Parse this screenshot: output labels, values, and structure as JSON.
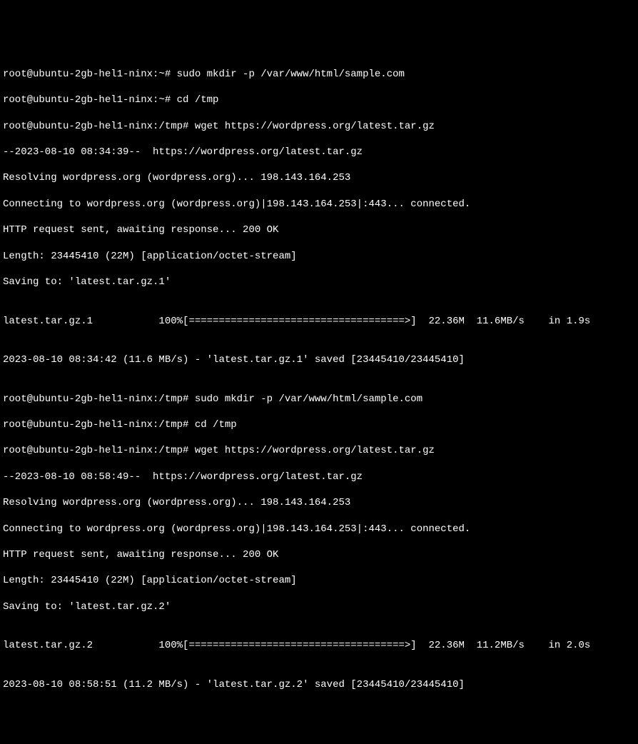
{
  "lines": [
    "root@ubuntu-2gb-hel1-ninx:~# sudo mkdir -p /var/www/html/sample.com",
    "root@ubuntu-2gb-hel1-ninx:~# cd /tmp",
    "root@ubuntu-2gb-hel1-ninx:/tmp# wget https://wordpress.org/latest.tar.gz",
    "--2023-08-10 08:34:39--  https://wordpress.org/latest.tar.gz",
    "Resolving wordpress.org (wordpress.org)... 198.143.164.253",
    "Connecting to wordpress.org (wordpress.org)|198.143.164.253|:443... connected.",
    "HTTP request sent, awaiting response... 200 OK",
    "Length: 23445410 (22M) [application/octet-stream]",
    "Saving to: 'latest.tar.gz.1'",
    "",
    "latest.tar.gz.1           100%[====================================>]  22.36M  11.6MB/s    in 1.9s",
    "",
    "2023-08-10 08:34:42 (11.6 MB/s) - 'latest.tar.gz.1' saved [23445410/23445410]",
    "",
    "root@ubuntu-2gb-hel1-ninx:/tmp# sudo mkdir -p /var/www/html/sample.com",
    "root@ubuntu-2gb-hel1-ninx:/tmp# cd /tmp",
    "root@ubuntu-2gb-hel1-ninx:/tmp# wget https://wordpress.org/latest.tar.gz",
    "--2023-08-10 08:58:49--  https://wordpress.org/latest.tar.gz",
    "Resolving wordpress.org (wordpress.org)... 198.143.164.253",
    "Connecting to wordpress.org (wordpress.org)|198.143.164.253|:443... connected.",
    "HTTP request sent, awaiting response... 200 OK",
    "Length: 23445410 (22M) [application/octet-stream]",
    "Saving to: 'latest.tar.gz.2'",
    "",
    "latest.tar.gz.2           100%[====================================>]  22.36M  11.2MB/s    in 2.0s",
    "",
    "2023-08-10 08:58:51 (11.2 MB/s) - 'latest.tar.gz.2' saved [23445410/23445410]"
  ]
}
